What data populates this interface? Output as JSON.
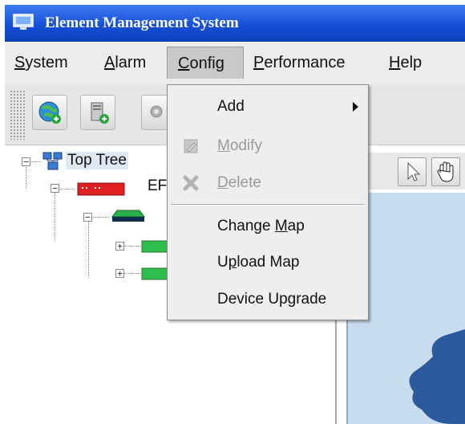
{
  "window": {
    "title": "Element Management System"
  },
  "menubar": {
    "items": [
      {
        "pre": "",
        "mn": "S",
        "post": "ystem"
      },
      {
        "pre": "",
        "mn": "A",
        "post": "larm"
      },
      {
        "pre": "",
        "mn": "C",
        "post": "onfig"
      },
      {
        "pre": "",
        "mn": "P",
        "post": "erformance"
      },
      {
        "pre": "",
        "mn": "H",
        "post": "elp"
      }
    ]
  },
  "tree": {
    "root": "Top Tree",
    "child1_partial": "EF"
  },
  "config_menu": {
    "items": [
      {
        "pre": "",
        "mn": "",
        "post": "Add",
        "enabled": true,
        "submenu": true
      },
      {
        "pre": "",
        "mn": "M",
        "post": "odify",
        "enabled": false
      },
      {
        "pre": "",
        "mn": "D",
        "post": "elete",
        "enabled": false
      },
      {
        "pre": "Change ",
        "mn": "M",
        "post": "ap",
        "enabled": true
      },
      {
        "pre": "U",
        "mn": "p",
        "post": "load Map",
        "enabled": true
      },
      {
        "pre": "Device Upgrade",
        "mn": "",
        "post": "",
        "enabled": true
      }
    ]
  },
  "colors": {
    "titlebar": "#1550d8",
    "device_red": "#e02020",
    "device_green": "#20b040"
  }
}
